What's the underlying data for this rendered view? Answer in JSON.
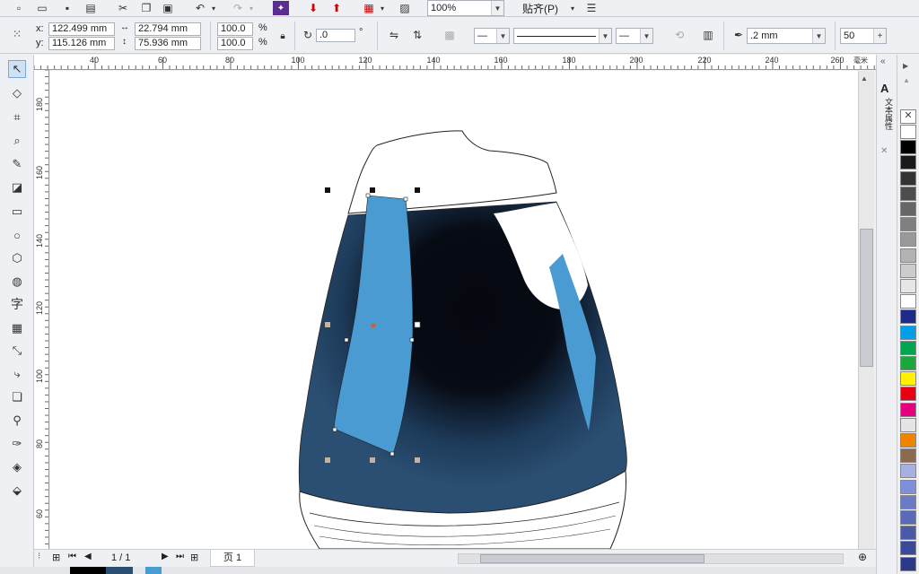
{
  "toolbar": {
    "zoom_value": "100%",
    "snap_label": "贴齐(P)"
  },
  "properties": {
    "x_label": "x:",
    "y_label": "y:",
    "x_value": "122.499 mm",
    "y_value": "115.126 mm",
    "width_value": "22.794 mm",
    "height_value": "75.936 mm",
    "scale_x": "100.0",
    "scale_y": "100.0",
    "percent": "%",
    "rotation_value": ".0",
    "degree": "°",
    "outline_width": ".2 mm",
    "miter_value": "50"
  },
  "rulers": {
    "h_ticks": [
      "40",
      "60",
      "80",
      "100",
      "120",
      "140",
      "160",
      "180",
      "200",
      "220",
      "240",
      "260"
    ],
    "unit": "毫米",
    "v_ticks": [
      "180",
      "160",
      "140",
      "120",
      "100",
      "80",
      "60"
    ]
  },
  "docker": {
    "tab_label": "文本属性"
  },
  "page_nav": {
    "page_count": "1 / 1",
    "page_tab": "页 1"
  },
  "palette": {
    "colors": [
      "#ffffff",
      "#000000",
      "#1a1a1a",
      "#333333",
      "#4d4d4d",
      "#666666",
      "#808080",
      "#999999",
      "#b3b3b3",
      "#cccccc",
      "#e6e6e6",
      "#ffffff",
      "#1e2a8a",
      "#00a0e9",
      "#00a650",
      "#1aa83c",
      "#fff100",
      "#e60012",
      "#e4007f",
      "#e5e5e5",
      "#f08300",
      "#8b6a4f",
      "#a7b0e0",
      "#7f8fd8",
      "#6a7bc8",
      "#5a6ab8",
      "#4a5aa8",
      "#3a4a98",
      "#2a3a88"
    ]
  },
  "colors": {
    "jar_dark": "#0a0f18",
    "jar_mid": "#2b4f72",
    "highlight": "#4b9bd3",
    "accent": "#5b2d91"
  }
}
